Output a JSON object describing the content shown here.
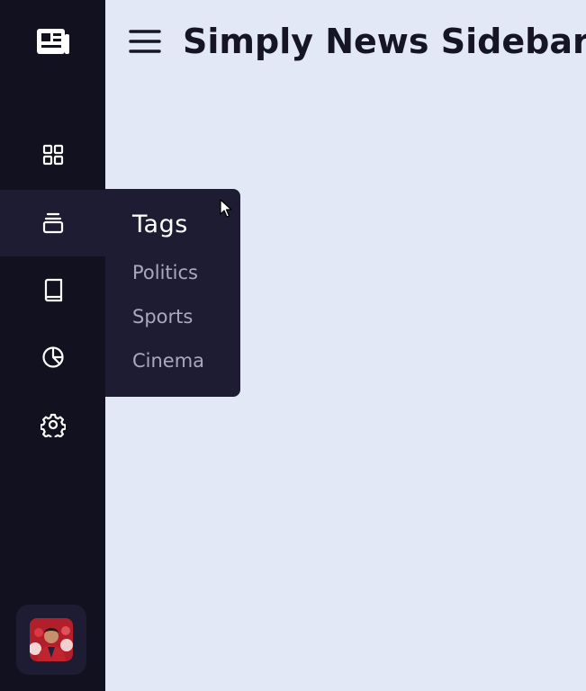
{
  "header": {
    "title": "Simply News Sidebar",
    "menu_icon": "hamburger-menu-icon"
  },
  "sidebar": {
    "logo_icon": "newspaper-icon",
    "items": [
      {
        "icon": "grid-dashboard-icon",
        "active": false
      },
      {
        "icon": "stacked-tags-icon",
        "active": true
      },
      {
        "icon": "book-icon",
        "active": false
      },
      {
        "icon": "pie-chart-icon",
        "active": false
      },
      {
        "icon": "gear-icon",
        "active": false
      }
    ],
    "avatar_icon": "user-avatar"
  },
  "flyout": {
    "title": "Tags",
    "links": [
      "Politics",
      "Sports",
      "Cinema"
    ]
  },
  "colors": {
    "background": "#e3e8f6",
    "sidebar": "#11111f",
    "active": "#1d1c33",
    "title_text": "#151526",
    "link_text": "#a9a9bd"
  }
}
